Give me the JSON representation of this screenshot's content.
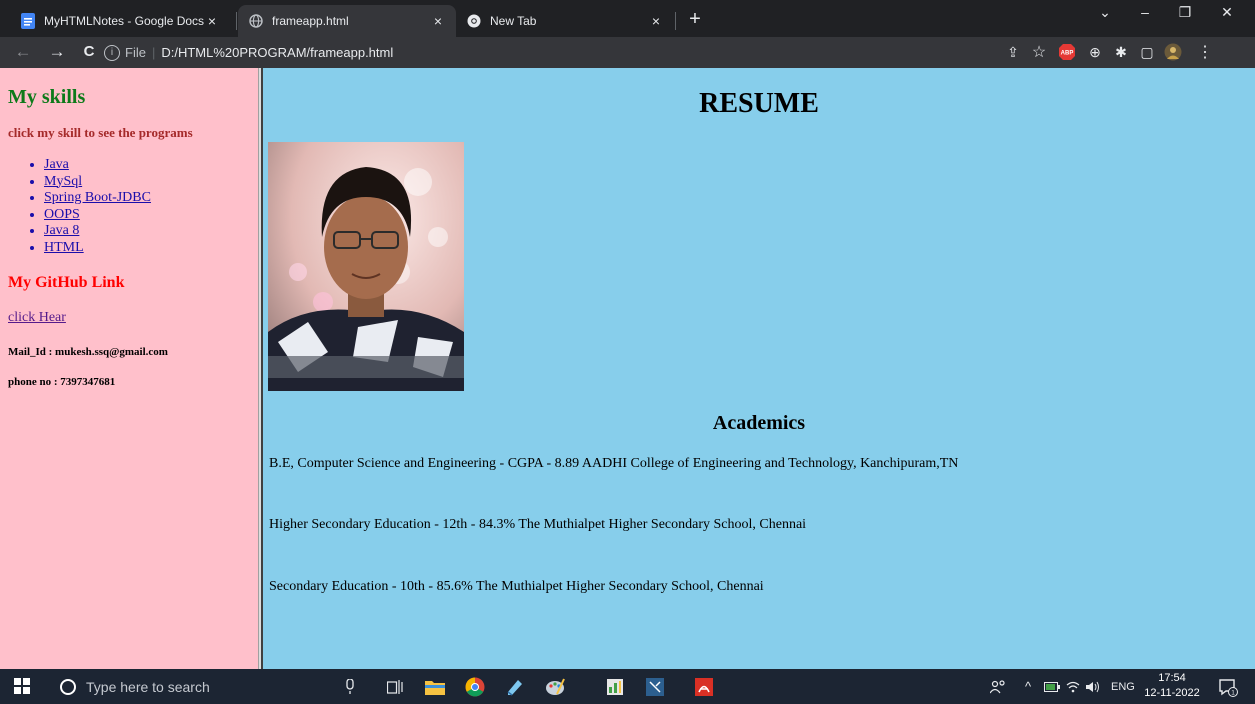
{
  "browser": {
    "tabs": [
      {
        "title": "MyHTMLNotes - Google Docs",
        "close": "×",
        "icon": "google-docs-icon",
        "active": false
      },
      {
        "title": "frameapp.html",
        "close": "×",
        "icon": "globe-icon",
        "active": true
      },
      {
        "title": "New Tab",
        "close": "×",
        "icon": "chrome-icon",
        "active": false
      }
    ],
    "new_tab": "+",
    "window_controls": {
      "dropdown": "⌄",
      "minimize": "–",
      "maximize": "❐",
      "close": "✕"
    },
    "nav": {
      "back": "←",
      "forward": "→",
      "reload": "C"
    },
    "address": {
      "scheme": "File",
      "url": "D:/HTML%20PROGRAM/frameapp.html",
      "info": "i"
    },
    "toolbar_icons": {
      "share": "⇪",
      "star": "☆",
      "abp": "ABP",
      "ext": "⊕",
      "puzzle": "✱",
      "sidepanel": "▢",
      "menu": "⋮"
    }
  },
  "left": {
    "title": "My skills",
    "subtitle": "click my skill to see the programs",
    "skills": [
      {
        "label": "Java"
      },
      {
        "label": "MySql"
      },
      {
        "label": "Spring Boot-JDBC"
      },
      {
        "label": "OOPS"
      },
      {
        "label": "Java 8"
      },
      {
        "label": "HTML"
      }
    ],
    "github_title": "My GitHub Link",
    "github_link": "click Hear",
    "mail": "Mail_Id : mukesh.ssq@gmail.com",
    "phone": "phone no : 7397347681"
  },
  "right": {
    "title": "RESUME",
    "academics_title": "Academics",
    "academics": [
      {
        "text": "B.E, Computer Science and Engineering - CGPA - 8.89 AADHI College of Engineering and Technology, Kanchipuram,TN"
      },
      {
        "text": "Higher Secondary Education - 12th - 84.3% The Muthialpet Higher Secondary School, Chennai"
      },
      {
        "text": "Secondary Education - 10th - 85.6% The Muthialpet Higher Secondary School, Chennai"
      }
    ]
  },
  "taskbar": {
    "search_placeholder": "Type here to search",
    "tray_lang": "ENG",
    "time": "17:54",
    "date": "12-11-2022",
    "notification_count": "1"
  },
  "colors": {
    "left_bg": "#ffc0cb",
    "right_bg": "#87ceeb",
    "skills_title": "#0d7a1a",
    "subtitle": "#a52a2a",
    "github_title": "#ff0000"
  }
}
